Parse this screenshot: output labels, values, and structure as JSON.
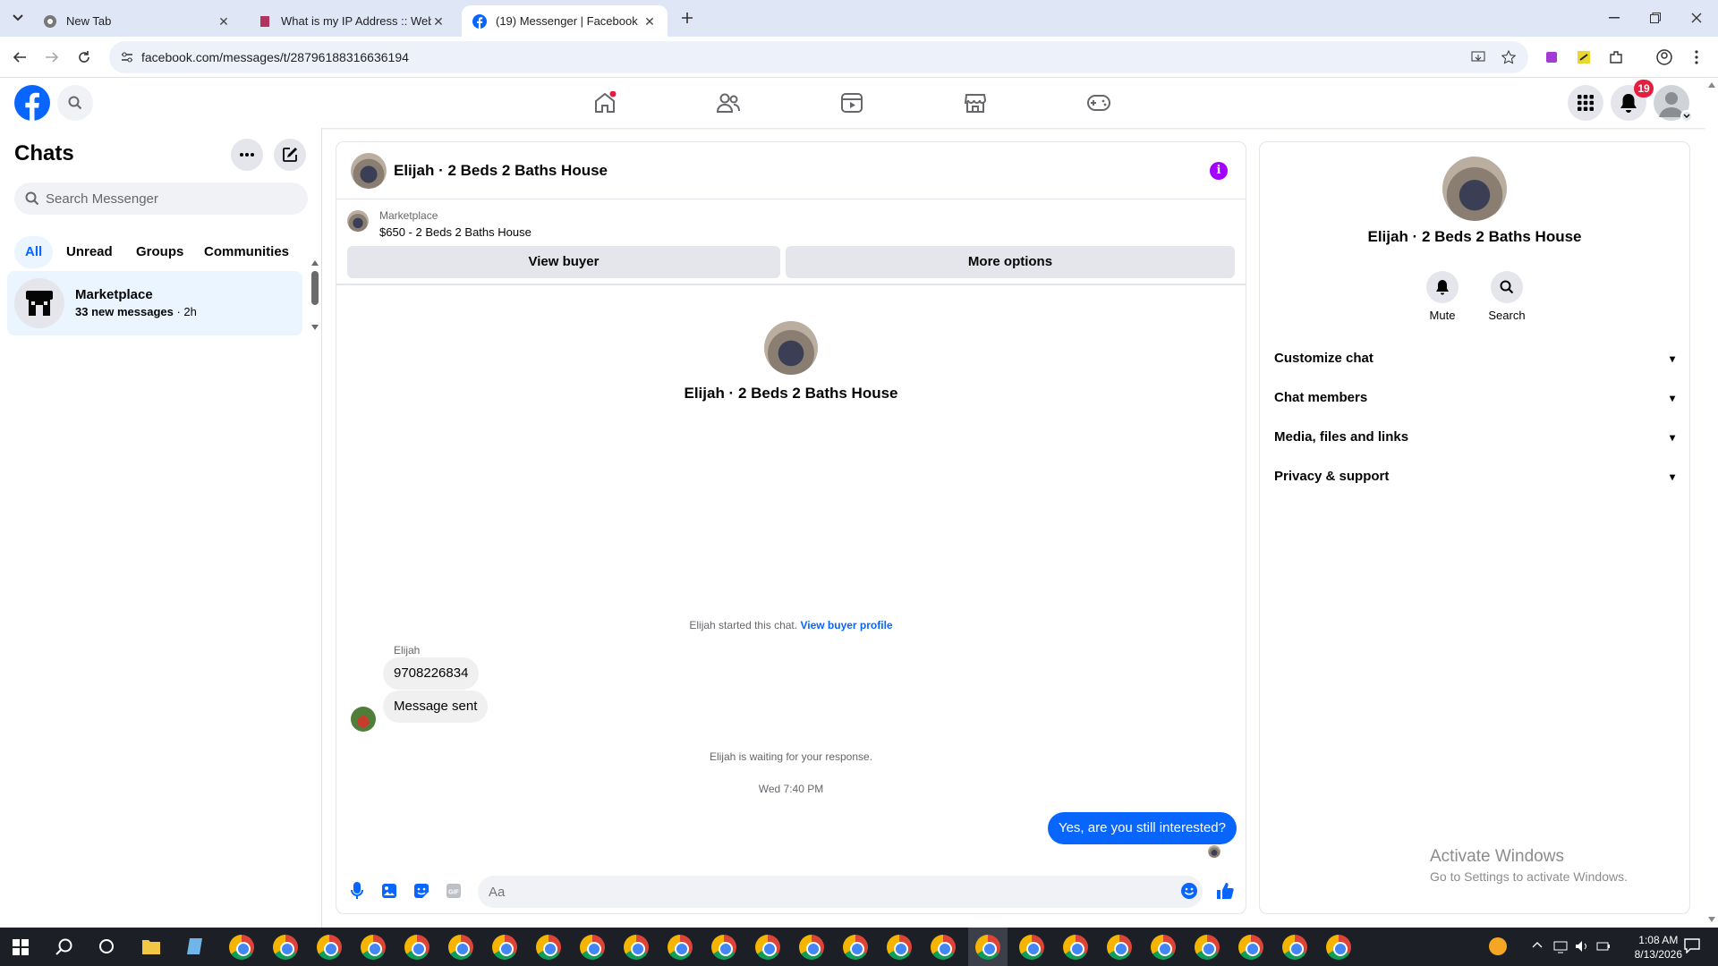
{
  "browser": {
    "tabs": [
      {
        "title": "New Tab",
        "active": false
      },
      {
        "title": "What is my IP Address :: WebBr",
        "active": false
      },
      {
        "title": "(19) Messenger | Facebook",
        "active": true
      }
    ],
    "url": "facebook.com/messages/t/28796188316636194"
  },
  "header": {
    "notification_count": "19"
  },
  "sidebar": {
    "title": "Chats",
    "search_placeholder": "Search Messenger",
    "filters": [
      "All",
      "Unread",
      "Groups",
      "Communities"
    ],
    "chat": {
      "name": "Marketplace",
      "new_messages": "33 new messages",
      "time": "2h"
    }
  },
  "conversation": {
    "title": "Elijah · 2 Beds 2 Baths House",
    "marketplace_label": "Marketplace",
    "listing": "$650 - 2 Beds 2 Baths House",
    "view_buyer": "View buyer",
    "more_options": "More options",
    "intro_name": "Elijah · 2 Beds 2 Baths House",
    "started_text": "Elijah started this chat.",
    "view_buyer_profile": "View buyer profile",
    "sender": "Elijah",
    "messages_in": [
      "9708226834",
      "Message sent"
    ],
    "waiting_text": "Elijah is waiting for your response.",
    "timestamp": "Wed 7:40 PM",
    "message_out": "Yes, are you still interested?",
    "input_placeholder": "Aa"
  },
  "details": {
    "name": "Elijah · 2 Beds 2 Baths House",
    "actions": [
      "Mute",
      "Search"
    ],
    "sections": [
      "Customize chat",
      "Chat members",
      "Media, files and links",
      "Privacy & support"
    ]
  },
  "watermark": {
    "line1": "Activate Windows",
    "line2": "Go to Settings to activate Windows."
  },
  "taskbar": {
    "time": "1:08 AM",
    "date": "8/13/2026"
  },
  "colors": {
    "accent": "#0866ff",
    "info": "#a200ff",
    "badge": "#e41e3f"
  }
}
